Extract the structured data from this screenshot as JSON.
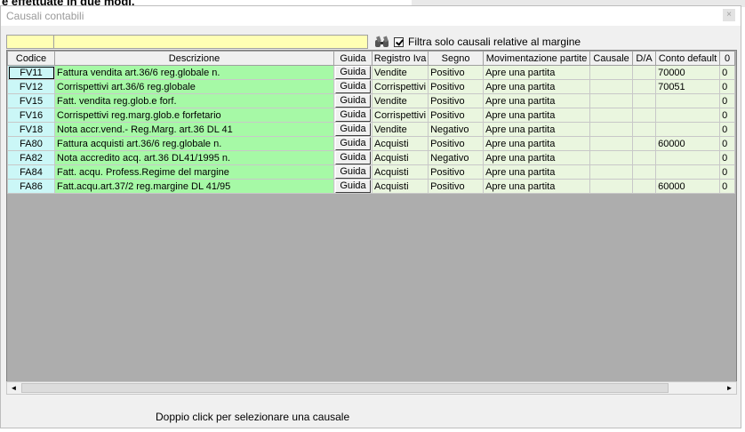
{
  "background": {
    "text": "e effettuate in due modi."
  },
  "window": {
    "title": "Causali contabili",
    "close": "×"
  },
  "filter": {
    "label": "Filtra solo causali relative al margine",
    "checked": true
  },
  "columns": [
    "Codice",
    "Descrizione",
    "Guida",
    "Registro Iva",
    "Segno",
    "Movimentazione partite",
    "Causale",
    "D/A",
    "Conto default",
    "0"
  ],
  "rows": [
    {
      "code": "FV11",
      "desc": "Fattura vendita art.36/6 reg.globale n.",
      "guida": "Guida",
      "registro": "Vendite",
      "segno": "Positivo",
      "mov": "Apre una partita",
      "causale": "",
      "da": "",
      "conto": "70000",
      "extra": "0"
    },
    {
      "code": "FV12",
      "desc": "Corrispettivi art.36/6 reg.globale",
      "guida": "Guida",
      "registro": "Corrispettivi",
      "segno": "Positivo",
      "mov": "Apre una partita",
      "causale": "",
      "da": "",
      "conto": "70051",
      "extra": "0"
    },
    {
      "code": "FV15",
      "desc": "Fatt. vendita reg.glob.e forf.",
      "guida": "Guida",
      "registro": "Vendite",
      "segno": "Positivo",
      "mov": "Apre una partita",
      "causale": "",
      "da": "",
      "conto": "",
      "extra": "0"
    },
    {
      "code": "FV16",
      "desc": "Corrispettivi reg.marg.glob.e forfetario",
      "guida": "Guida",
      "registro": "Corrispettivi",
      "segno": "Positivo",
      "mov": "Apre una partita",
      "causale": "",
      "da": "",
      "conto": "",
      "extra": "0"
    },
    {
      "code": "FV18",
      "desc": "Nota accr.vend.- Reg.Marg. art.36 DL 41",
      "guida": "Guida",
      "registro": "Vendite",
      "segno": "Negativo",
      "mov": "Apre una partita",
      "causale": "",
      "da": "",
      "conto": "",
      "extra": "0"
    },
    {
      "code": "FA80",
      "desc": "Fattura acquisti art.36/6 reg.globale n.",
      "guida": "Guida",
      "registro": "Acquisti",
      "segno": "Positivo",
      "mov": "Apre una partita",
      "causale": "",
      "da": "",
      "conto": "60000",
      "extra": "0"
    },
    {
      "code": "FA82",
      "desc": "Nota accredito acq. art.36 DL41/1995 n.",
      "guida": "Guida",
      "registro": "Acquisti",
      "segno": "Negativo",
      "mov": "Apre una partita",
      "causale": "",
      "da": "",
      "conto": "",
      "extra": "0"
    },
    {
      "code": "FA84",
      "desc": "Fatt. acqu. Profess.Regime del margine",
      "guida": "Guida",
      "registro": "Acquisti",
      "segno": "Positivo",
      "mov": "Apre una partita",
      "causale": "",
      "da": "",
      "conto": "",
      "extra": "0"
    },
    {
      "code": "FA86",
      "desc": "Fatt.acqu.art.37/2 reg.margine DL 41/95",
      "guida": "Guida",
      "registro": "Acquisti",
      "segno": "Positivo",
      "mov": "Apre una partita",
      "causale": "",
      "da": "",
      "conto": "60000",
      "extra": "0"
    }
  ],
  "scroll": {
    "left": "◄",
    "right": "►"
  },
  "status": "Doppio click per selezionare una causale"
}
